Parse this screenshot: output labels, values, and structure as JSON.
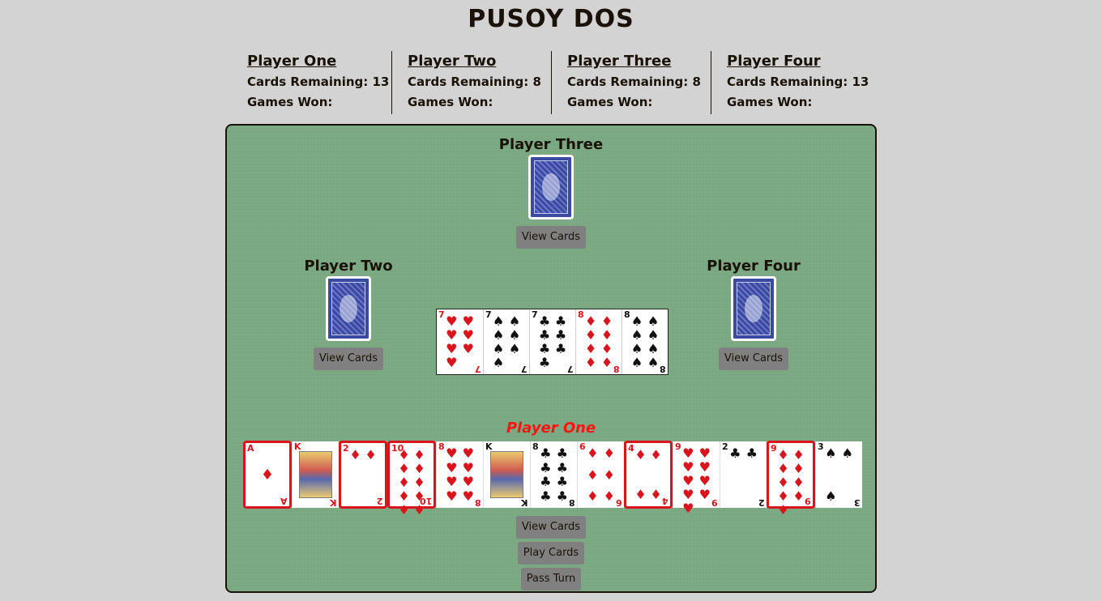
{
  "app": {
    "title": "PUSOY DOS"
  },
  "scoreboard": [
    {
      "name": "Player One",
      "cards_label": "Cards Remaining: 13",
      "won_label": "Games Won:"
    },
    {
      "name": "Player Two",
      "cards_label": "Cards Remaining: 8",
      "won_label": "Games Won:"
    },
    {
      "name": "Player Three",
      "cards_label": "Cards Remaining: 8",
      "won_label": "Games Won:"
    },
    {
      "name": "Player Four",
      "cards_label": "Cards Remaining: 13",
      "won_label": "Games Won:"
    }
  ],
  "seats": {
    "top": {
      "name": "Player Three",
      "button": "View Cards"
    },
    "left": {
      "name": "Player Two",
      "button": "View Cards"
    },
    "right": {
      "name": "Player Four",
      "button": "View Cards"
    }
  },
  "pile": [
    {
      "rank": "7",
      "suit": "♥",
      "color": "#d9141c"
    },
    {
      "rank": "7",
      "suit": "♠",
      "color": "#111111"
    },
    {
      "rank": "7",
      "suit": "♣",
      "color": "#111111"
    },
    {
      "rank": "8",
      "suit": "♦",
      "color": "#d9141c"
    },
    {
      "rank": "8",
      "suit": "♠",
      "color": "#111111"
    }
  ],
  "player_one": {
    "name": "Player One",
    "hand": [
      {
        "rank": "A",
        "suit": "♦",
        "color": "#d9141c",
        "selected": true
      },
      {
        "rank": "K",
        "suit": "♥",
        "color": "#d9141c",
        "selected": false,
        "face": true
      },
      {
        "rank": "2",
        "suit": "♦",
        "color": "#d9141c",
        "selected": true
      },
      {
        "rank": "10",
        "suit": "♦",
        "color": "#d9141c",
        "selected": true
      },
      {
        "rank": "8",
        "suit": "♥",
        "color": "#d9141c",
        "selected": false
      },
      {
        "rank": "K",
        "suit": "♠",
        "color": "#111111",
        "selected": false,
        "face": true
      },
      {
        "rank": "8",
        "suit": "♣",
        "color": "#111111",
        "selected": false
      },
      {
        "rank": "6",
        "suit": "♦",
        "color": "#d9141c",
        "selected": false
      },
      {
        "rank": "4",
        "suit": "♦",
        "color": "#d9141c",
        "selected": true
      },
      {
        "rank": "9",
        "suit": "♥",
        "color": "#d9141c",
        "selected": false
      },
      {
        "rank": "2",
        "suit": "♣",
        "color": "#111111",
        "selected": false
      },
      {
        "rank": "9",
        "suit": "♦",
        "color": "#d9141c",
        "selected": true
      },
      {
        "rank": "3",
        "suit": "♠",
        "color": "#111111",
        "selected": false
      }
    ],
    "buttons": {
      "view": "View Cards",
      "play": "Play Cards",
      "pass": "Pass Turn"
    }
  },
  "colors": {
    "felt": "#7aa981",
    "background": "#d3d3d3",
    "active_player": "#ff1414",
    "button": "#808080"
  }
}
